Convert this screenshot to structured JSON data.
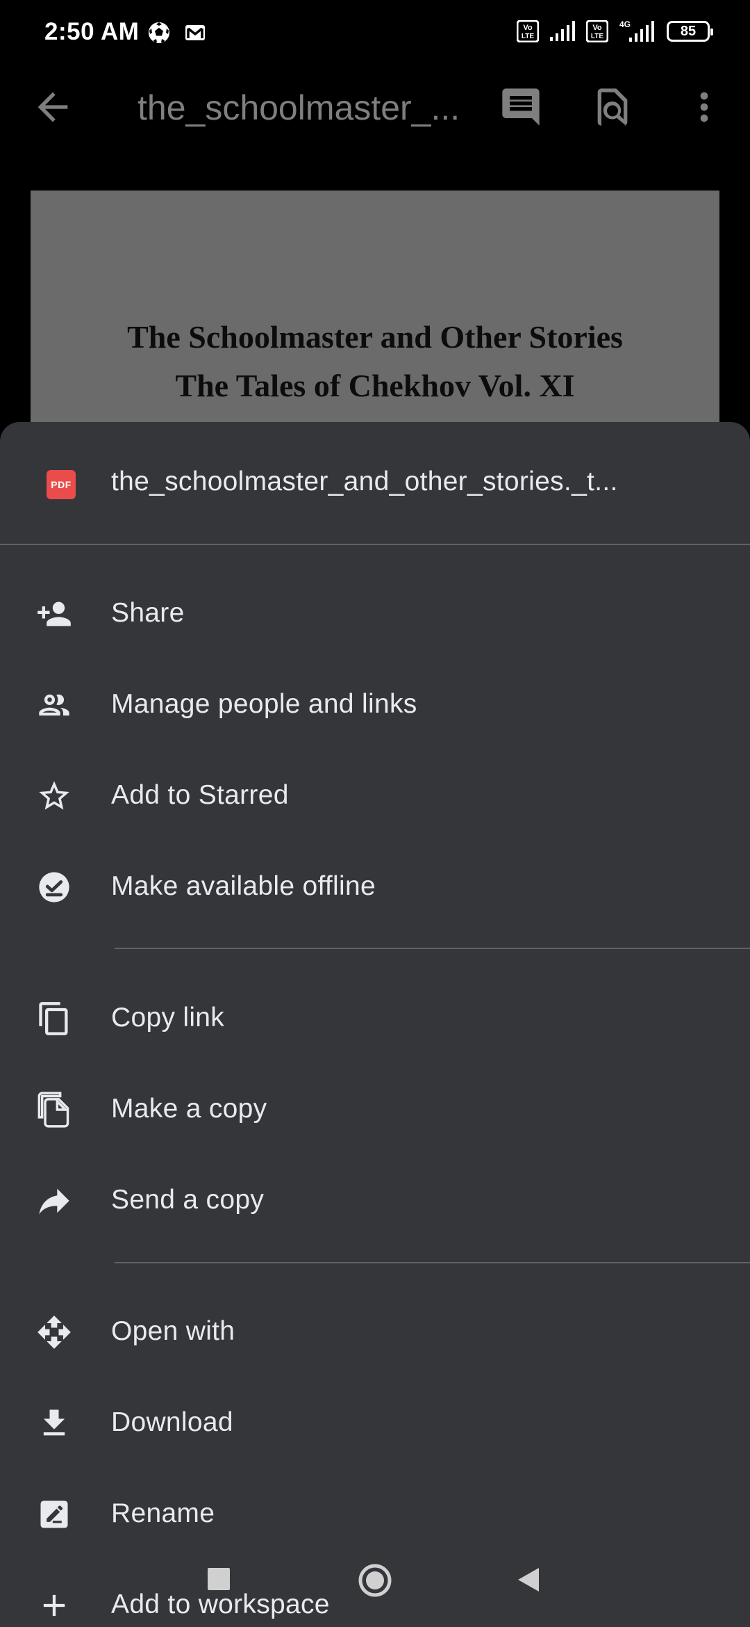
{
  "status_bar": {
    "time": "2:50 AM",
    "left_icons": [
      "soccer-ball-icon",
      "gmail-icon"
    ],
    "right_icons": [
      "volte-icon",
      "signal-icon",
      "volte-icon",
      "4g-signal-icon",
      "battery-icon"
    ],
    "network_type": "4G",
    "volte_label": "Vo LTE",
    "battery_level": "85"
  },
  "toolbar": {
    "title": "the_schoolmaster_...",
    "icons": [
      "back-arrow-icon",
      "comment-icon",
      "find-in-page-icon",
      "more-vert-icon"
    ]
  },
  "document": {
    "heading_line1": "The Schoolmaster and Other Stories",
    "heading_line2": "The Tales of Chekhov Vol. XI"
  },
  "sheet": {
    "file_badge": "PDF",
    "file_name": "the_schoolmaster_and_other_stories._t...",
    "groups": [
      [
        {
          "label": "Share",
          "icon": "person-add-icon"
        },
        {
          "label": "Manage people and links",
          "icon": "people-icon"
        },
        {
          "label": "Add to Starred",
          "icon": "star-outline-icon"
        },
        {
          "label": "Make available offline",
          "icon": "offline-check-icon"
        }
      ],
      [
        {
          "label": "Copy link",
          "icon": "copy-link-icon"
        },
        {
          "label": "Make a copy",
          "icon": "file-copy-icon"
        },
        {
          "label": "Send a copy",
          "icon": "forward-arrow-icon"
        }
      ],
      [
        {
          "label": "Open with",
          "icon": "open-with-icon"
        },
        {
          "label": "Download",
          "icon": "download-icon"
        },
        {
          "label": "Rename",
          "icon": "rename-icon"
        },
        {
          "label": "Add to workspace",
          "icon": "plus-icon"
        }
      ]
    ]
  },
  "nav_bar": {
    "buttons": [
      "recents-square-icon",
      "home-circle-icon",
      "back-triangle-icon"
    ]
  },
  "colors": {
    "sheet_background": "#35363a",
    "divider": "#5f6368",
    "text_primary": "#e8eaed",
    "icon": "#e8eaed",
    "pdf_red": "#ea4c4c",
    "doc_page": "#6b6b6b"
  }
}
